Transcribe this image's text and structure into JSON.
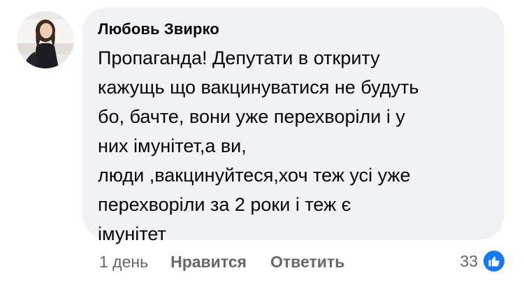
{
  "comment": {
    "author": "Любовь Звирко",
    "text": "Пропаганда! Депутати в откриту\nкажущь що вакцинуватися не будуть\nбо, бачте, вони уже перехворіли і у\nних імунітет,а ви,\nлюди ,вакцинуйтеся,хоч теж усі уже\nперехворіли за 2 роки і теж є\nімунітет",
    "time": "1 день",
    "like_label": "Нравится",
    "reply_label": "Ответить",
    "reaction_count": "33",
    "reaction_icon": "like-icon",
    "colors": {
      "bubble": "#f0f2f5",
      "meta_text": "#65676b",
      "like_blue": "#1877f2"
    }
  }
}
